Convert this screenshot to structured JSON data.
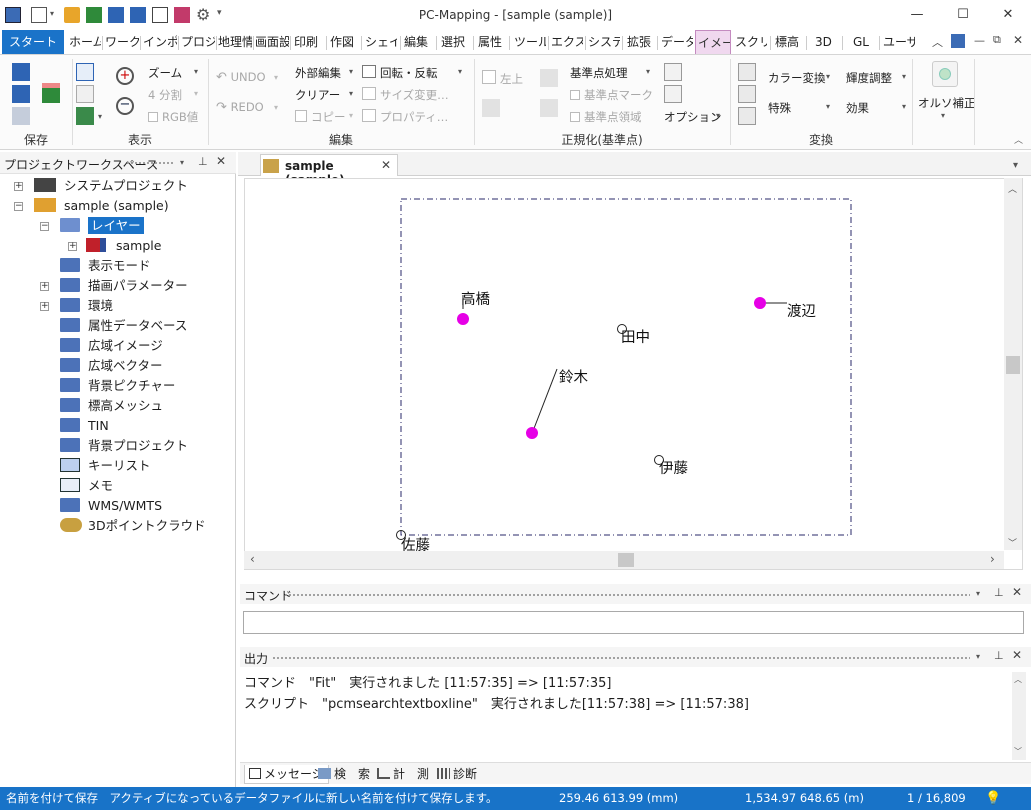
{
  "window": {
    "title": "PC-Mapping - [sample (sample)]",
    "min": "—",
    "max": "☐",
    "close": "✕"
  },
  "ribbon_tabs": [
    "スタート",
    "ホーム",
    "ワークス",
    "インポ",
    "プロジ",
    "地理情",
    "画面設",
    "印刷",
    "作図",
    "シェイプ",
    "編集",
    "選択",
    "属性",
    "ツール",
    "エクス",
    "システ",
    "拡張",
    "データ",
    "イメー",
    "スクリ",
    "標高",
    "3D",
    "GL",
    "ユーザ"
  ],
  "ribbon": {
    "zoom": "ズーム",
    "split": "4 分割",
    "rgb": "RGB値",
    "undo": "UNDO",
    "redo": "REDO",
    "external_edit": "外部編集",
    "clear": "クリアー",
    "copy": "コピー",
    "rotate": "回転・反転",
    "size_change": "サイズ変更…",
    "property": "プロパティ…",
    "top_left": "左上",
    "ref_proc": "基準点処理",
    "ref_mark": "基準点マーク",
    "ref_area": "基準点領域",
    "option": "オプション",
    "color_conv": "カラー変換",
    "special": "特殊",
    "brightness": "輝度調整",
    "effect": "効果",
    "ortho": "オルソ補正",
    "groups": {
      "save": "保存",
      "display": "表示",
      "edit": "編集",
      "normalize": "正規化(基準点)",
      "convert": "変換"
    }
  },
  "workspace": {
    "title": "プロジェクトワークスペース",
    "system_project": "システムプロジェクト",
    "project": "sample (sample)",
    "layer": "レイヤー",
    "layer_child": "sample",
    "folders": [
      "表示モード",
      "描画パラメーター",
      "環境",
      "属性データベース",
      "広域イメージ",
      "広域ベクター",
      "背景ピクチャー",
      "標高メッシュ",
      "TIN",
      "背景プロジェクト",
      "キーリスト",
      "メモ",
      "WMS/WMTS",
      "3Dポイントクラウド"
    ]
  },
  "document_tab": "sample (sample)",
  "map_labels": {
    "takahashi": "高橋",
    "watanabe": "渡辺",
    "tanaka": "田中",
    "suzuki": "鈴木",
    "ito": "伊藤",
    "sato": "佐藤"
  },
  "command": {
    "title": "コマンド",
    "value": ""
  },
  "output": {
    "title": "出力",
    "lines": [
      "コマンド　\"Fit\"　実行されました [11:57:35] => [11:57:35]",
      "スクリプト　\"pcmsearchtextboxline\"　実行されました[11:57:38] => [11:57:38]"
    ],
    "tabs": [
      "メッセージ",
      "検　索",
      "計　測",
      "診断"
    ]
  },
  "status": {
    "message": "名前を付けて保存　アクティブになっているデータファイルに新しい名前を付けて保存します。",
    "coord1": "259.46 613.99 (mm)",
    "coord2": "1,534.97 648.65 (m)",
    "scale": "1 / 16,809"
  },
  "colors": {
    "accent": "#1a73c9",
    "status_bg": "#1873c8",
    "point": "#e600e6",
    "folder": "#4c72b8"
  }
}
